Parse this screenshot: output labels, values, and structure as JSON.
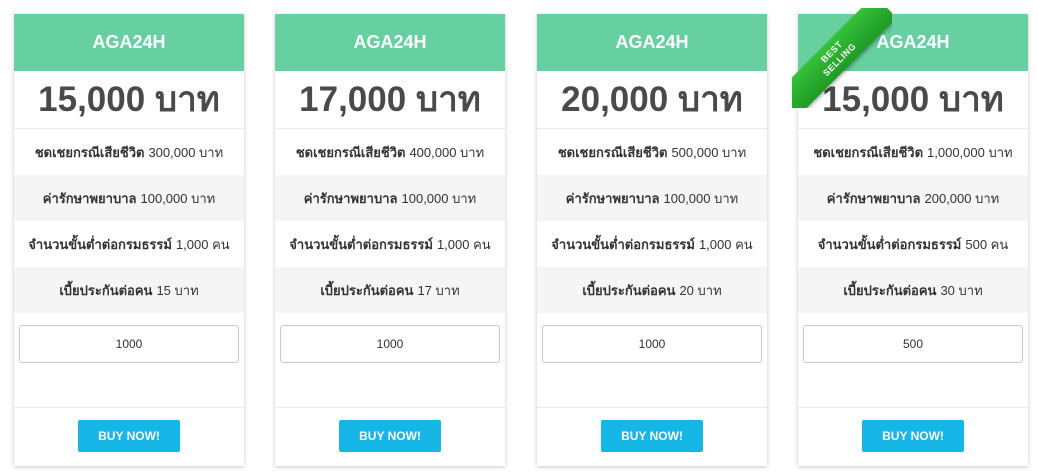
{
  "plans": [
    {
      "title": "AGA24H",
      "price": "15,000 บาท",
      "features": [
        {
          "label": "ชดเชยกรณีเสียชีวิต",
          "value": "300,000 บาท"
        },
        {
          "label": "ค่ารักษาพยาบาล",
          "value": "100,000 บาท"
        },
        {
          "label": "จำนวนขั้นต่ำต่อกรมธรรม์",
          "value": "1,000 คน"
        },
        {
          "label": "เบี้ยประกันต่อคน",
          "value": "15 บาท"
        }
      ],
      "quantity": "1000",
      "button": "BUY NOW!"
    },
    {
      "title": "AGA24H",
      "price": "17,000 บาท",
      "features": [
        {
          "label": "ชดเชยกรณีเสียชีวิต",
          "value": "400,000 บาท"
        },
        {
          "label": "ค่ารักษาพยาบาล",
          "value": "100,000 บาท"
        },
        {
          "label": "จำนวนขั้นต่ำต่อกรมธรรม์",
          "value": "1,000 คน"
        },
        {
          "label": "เบี้ยประกันต่อคน",
          "value": "17 บาท"
        }
      ],
      "quantity": "1000",
      "button": "BUY NOW!"
    },
    {
      "title": "AGA24H",
      "price": "20,000 บาท",
      "features": [
        {
          "label": "ชดเชยกรณีเสียชีวิต",
          "value": "500,000 บาท"
        },
        {
          "label": "ค่ารักษาพยาบาล",
          "value": "100,000 บาท"
        },
        {
          "label": "จำนวนขั้นต่ำต่อกรมธรรม์",
          "value": "1,000 คน"
        },
        {
          "label": "เบี้ยประกันต่อคน",
          "value": "20 บาท"
        }
      ],
      "quantity": "1000",
      "button": "BUY NOW!"
    },
    {
      "title": "AGA24H",
      "price": "15,000 บาท",
      "features": [
        {
          "label": "ชดเชยกรณีเสียชีวิต",
          "value": "1,000,000 บาท"
        },
        {
          "label": "ค่ารักษาพยาบาล",
          "value": "200,000 บาท"
        },
        {
          "label": "จำนวนขั้นต่ำต่อกรมธรรม์",
          "value": "500 คน"
        },
        {
          "label": "เบี้ยประกันต่อคน",
          "value": "30 บาท"
        }
      ],
      "quantity": "500",
      "button": "BUY NOW!",
      "ribbon": {
        "line1": "BEST",
        "line2": "SELLING"
      }
    }
  ],
  "colors": {
    "header_bg": "#66d0a0",
    "button_bg": "#16b7e6",
    "ribbon_bg": "#2bb532",
    "price_text": "#4a4a4a"
  }
}
